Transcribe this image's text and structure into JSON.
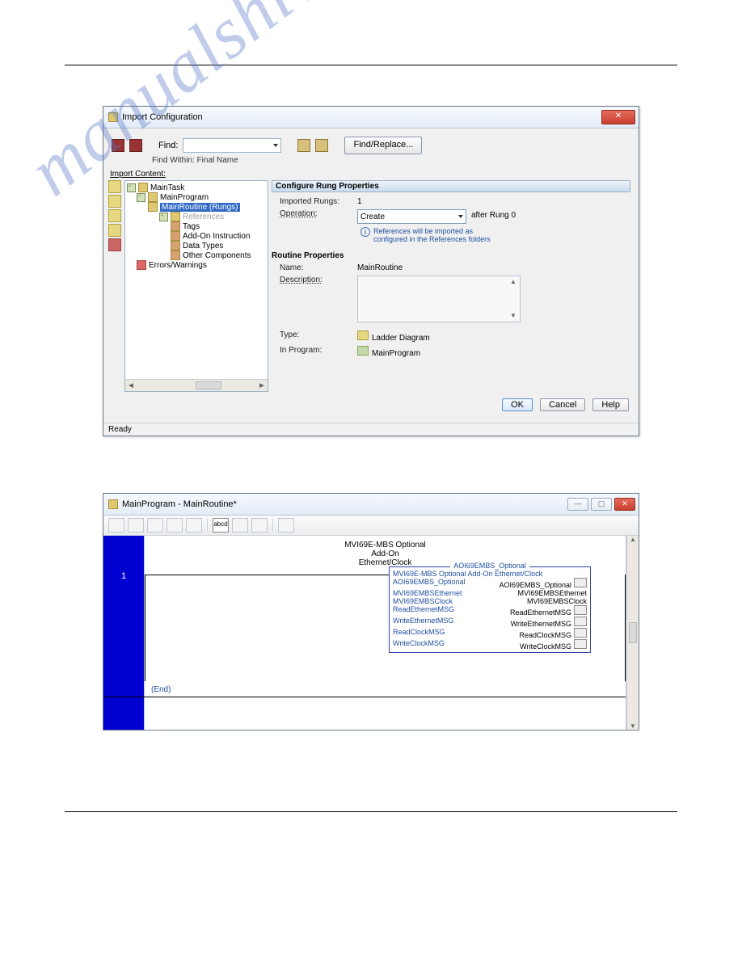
{
  "dialog": {
    "title": "Import Configuration",
    "find_label": "Find:",
    "find_within": "Find Within: Final Name",
    "find_replace_btn": "Find/Replace...",
    "import_content_label": "Import Content:",
    "tree": {
      "root": "MainTask",
      "program": "MainProgram",
      "routine_sel": "MainRoutine (Rungs)",
      "references": "References",
      "tags": "Tags",
      "addon": "Add-On Instruction",
      "datatypes": "Data Types",
      "other": "Other Components",
      "errors": "Errors/Warnings"
    },
    "props": {
      "section": "Configure Rung Properties",
      "imported_rungs_label": "Imported Rungs:",
      "imported_rungs_value": "1",
      "operation_label": "Operation:",
      "operation_value": "Create",
      "operation_suffix": "after Rung 0",
      "info1": "References will be imported as",
      "info2": "configured in the References folders",
      "routine_section": "Routine Properties",
      "name_label": "Name:",
      "name_value": "MainRoutine",
      "desc_label": "Description:",
      "type_label": "Type:",
      "type_value": "Ladder Diagram",
      "inprog_label": "In Program:",
      "inprog_value": "MainProgram"
    },
    "buttons": {
      "ok": "OK",
      "cancel": "Cancel",
      "help": "Help"
    },
    "status": "Ready"
  },
  "editor": {
    "title": "MainProgram - MainRoutine*",
    "toolbar_abcd": "abcd",
    "rung_number": "1",
    "header_lines": [
      "MVI69E-MBS Optional",
      "Add-On",
      "Ethernet/Clock"
    ],
    "aoi": {
      "title": "AOI69EMBS_Optional",
      "rows": [
        {
          "l": "MVI69E-MBS Optional Add-On Ethernet/Clock",
          "r": ""
        },
        {
          "l": "AOI69EMBS_Optional",
          "r": "AOI69EMBS_Optional",
          "box": true
        },
        {
          "l": "MVI69EMBSEthernet",
          "r": "MVI69EMBSEthernet"
        },
        {
          "l": "MVI69EMBSClock",
          "r": "MVI69EMBSClock"
        },
        {
          "l": "ReadEthernetMSG",
          "r": "ReadEthernetMSG",
          "box": true
        },
        {
          "l": "WriteEthernetMSG",
          "r": "WriteEthernetMSG",
          "box": true
        },
        {
          "l": "ReadClockMSG",
          "r": "ReadClockMSG",
          "box": true
        },
        {
          "l": "WriteClockMSG",
          "r": "WriteClockMSG",
          "box": true
        }
      ]
    },
    "end_label": "(End)"
  },
  "watermark": "manualshive.com"
}
